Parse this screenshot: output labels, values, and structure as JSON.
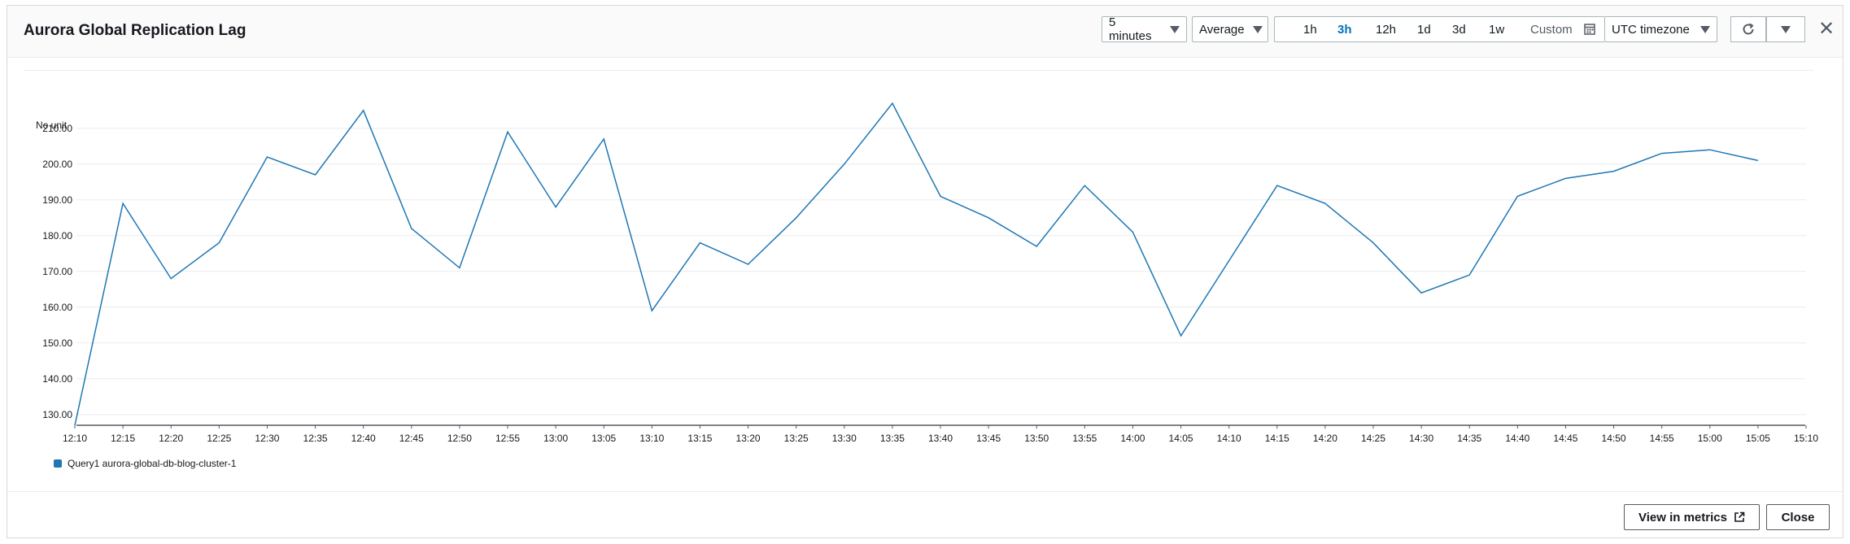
{
  "header": {
    "title": "Aurora Global Replication Lag",
    "period_select": "5 minutes",
    "statistic_select": "Average",
    "time_ranges": [
      "1h",
      "3h",
      "12h",
      "1d",
      "3d",
      "1w"
    ],
    "active_range": "3h",
    "custom_label": "Custom",
    "timezone_select": "UTC timezone"
  },
  "footer": {
    "view_in_metrics_label": "View in metrics",
    "close_label": "Close"
  },
  "colors": {
    "series": "#1f77b4",
    "accent": "#0073bb"
  },
  "chart_data": {
    "type": "line",
    "ylabel": "No unit",
    "ylim": [
      127,
      217
    ],
    "yticks": [
      130,
      140,
      150,
      160,
      170,
      180,
      190,
      200,
      210
    ],
    "ytick_labels": [
      "130.00",
      "140.00",
      "150.00",
      "160.00",
      "170.00",
      "180.00",
      "190.00",
      "200.00",
      "210.00"
    ],
    "xtick_labels": [
      "12:10",
      "12:15",
      "12:20",
      "12:25",
      "12:30",
      "12:35",
      "12:40",
      "12:45",
      "12:50",
      "12:55",
      "13:00",
      "13:05",
      "13:10",
      "13:15",
      "13:20",
      "13:25",
      "13:30",
      "13:35",
      "13:40",
      "13:45",
      "13:50",
      "13:55",
      "14:00",
      "14:05",
      "14:10",
      "14:15",
      "14:20",
      "14:25",
      "14:30",
      "14:35",
      "14:40",
      "14:45",
      "14:50",
      "14:55",
      "15:00",
      "15:05",
      "15:10"
    ],
    "series": [
      {
        "name": "Query1 aurora-global-db-blog-cluster-1",
        "x": [
          "12:10",
          "12:15",
          "12:20",
          "12:25",
          "12:30",
          "12:35",
          "12:40",
          "12:45",
          "12:50",
          "12:55",
          "13:00",
          "13:05",
          "13:10",
          "13:15",
          "13:20",
          "13:25",
          "13:30",
          "13:35",
          "13:40",
          "13:45",
          "13:50",
          "13:55",
          "14:00",
          "14:05",
          "14:10",
          "14:15",
          "14:20",
          "14:25",
          "14:30",
          "14:35",
          "14:40",
          "14:45",
          "14:50",
          "14:55",
          "15:00",
          "15:05"
        ],
        "values": [
          127,
          189,
          168,
          178,
          202,
          197,
          215,
          182,
          171,
          209,
          188,
          207,
          159,
          178,
          172,
          185,
          200,
          217,
          191,
          185,
          177,
          194,
          181,
          152,
          173,
          194,
          189,
          178,
          164,
          169,
          191,
          196,
          198,
          203,
          204,
          201
        ]
      }
    ],
    "grid": true,
    "legend": "bottom-left"
  }
}
